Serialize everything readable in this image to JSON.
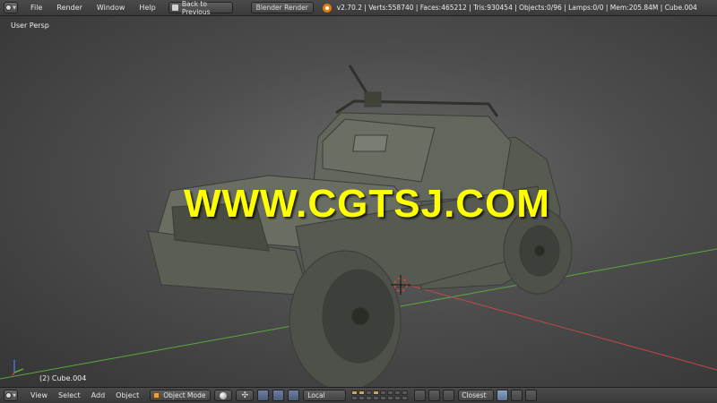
{
  "topbar": {
    "menus": [
      "File",
      "Render",
      "Window",
      "Help"
    ],
    "back_button": "Back to Previous",
    "render_engine": "Blender Render",
    "stats": "v2.70.2 | Verts:558740 | Faces:465212 | Tris:930454 | Objects:0/96 | Lamps:0/0 | Mem:205.84M | Cube.004"
  },
  "viewport": {
    "view_label": "User Persp",
    "object_label": "(2) Cube.004",
    "watermark": "WWW.CGTSJ.COM"
  },
  "bottombar": {
    "menus": [
      "View",
      "Select",
      "Add",
      "Object"
    ],
    "mode": "Object Mode",
    "transform_space": "Local",
    "snap_target": "Closest"
  },
  "colors": {
    "x_axis": "#c04848",
    "y_axis": "#5aa83c",
    "watermark": "#ffff00",
    "accent": "#e87d0d"
  }
}
